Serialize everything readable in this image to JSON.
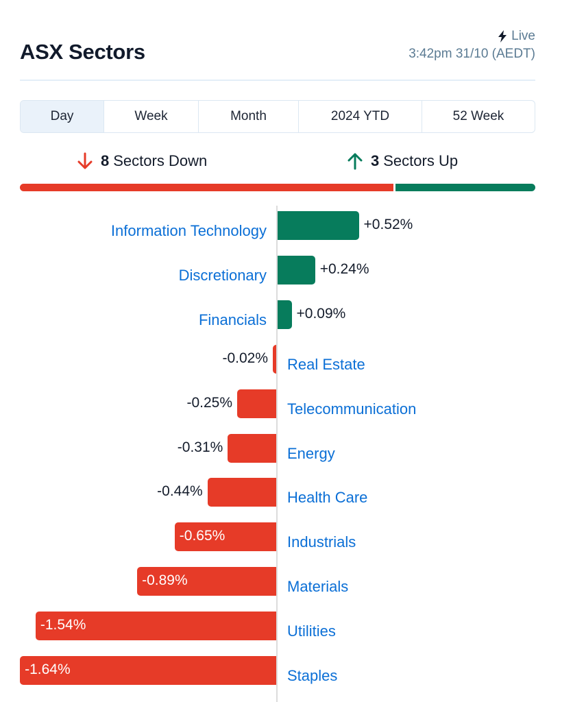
{
  "header": {
    "title": "ASX Sectors",
    "live_icon": "lightning-icon",
    "live_label": "Live",
    "timestamp": "3:42pm 31/10 (AEDT)"
  },
  "tabs": [
    {
      "label": "Day",
      "active": true
    },
    {
      "label": "Week",
      "active": false
    },
    {
      "label": "Month",
      "active": false
    },
    {
      "label": "2024 YTD",
      "active": false
    },
    {
      "label": "52 Week",
      "active": false
    }
  ],
  "summary": {
    "down_count": "8",
    "down_label": "Sectors Down",
    "down_icon": "arrow-down-icon",
    "up_count": "3",
    "up_label": "Sectors Up",
    "up_icon": "arrow-up-icon",
    "down_fraction": 0.727,
    "up_fraction": 0.273
  },
  "colors": {
    "positive": "#077c5c",
    "negative": "#e63b28",
    "label": "#0b6fd6",
    "muted": "#5b7b93"
  },
  "chart_data": {
    "type": "bar",
    "orientation": "horizontal-diverging",
    "title": "ASX Sectors",
    "period": "Day",
    "unit": "%",
    "categories": [
      "Information Technology",
      "Discretionary",
      "Financials",
      "Real Estate",
      "Telecommunication",
      "Energy",
      "Health Care",
      "Industrials",
      "Materials",
      "Utilities",
      "Staples"
    ],
    "values": [
      0.52,
      0.24,
      0.09,
      -0.02,
      -0.25,
      -0.31,
      -0.44,
      -0.65,
      -0.89,
      -1.54,
      -1.64
    ],
    "value_labels": [
      "+0.52%",
      "+0.24%",
      "+0.09%",
      "-0.02%",
      "-0.25%",
      "-0.31%",
      "-0.44%",
      "-0.65%",
      "-0.89%",
      "-1.54%",
      "-1.64%"
    ],
    "xlim": [
      -1.64,
      0.52
    ],
    "grid": false,
    "legend": "none"
  }
}
